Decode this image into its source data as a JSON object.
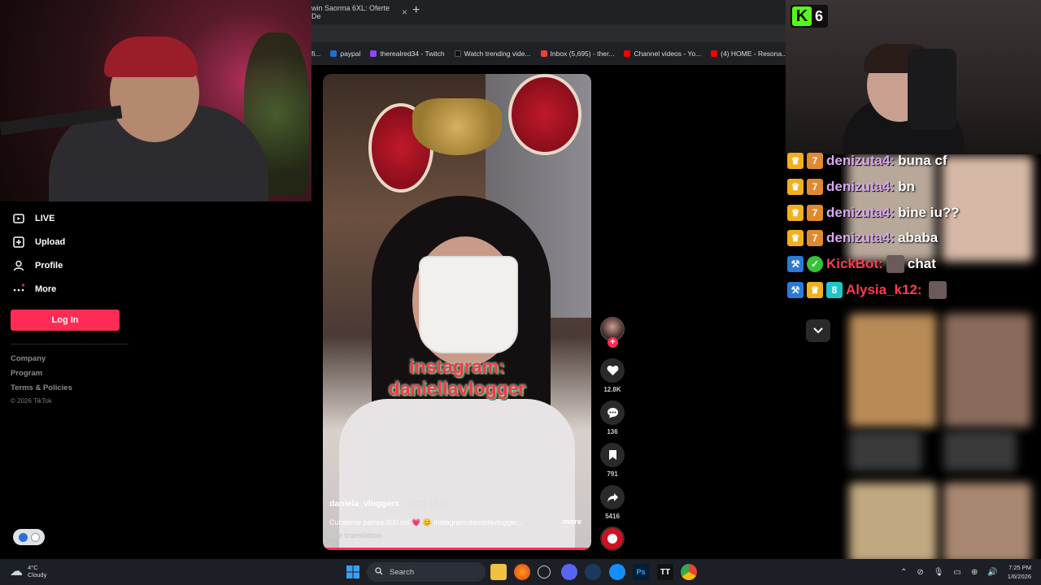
{
  "streamer_overlay": {
    "kick_viewer_count": "6"
  },
  "browser": {
    "active_tab_title": "win Saorma 6XL: Oferte De",
    "bookmarks": [
      {
        "label": "fi..."
      },
      {
        "label": "paypal"
      },
      {
        "label": "therealred34 - Twitch"
      },
      {
        "label": "Watch trending vide..."
      },
      {
        "label": "Inbox (5,695) - ther..."
      },
      {
        "label": "Channel videos - Yo..."
      },
      {
        "label": "(4) HOME - Resona..."
      }
    ]
  },
  "tiktok_sidebar": {
    "nav": [
      {
        "label": "LIVE",
        "icon": "live-icon"
      },
      {
        "label": "Upload",
        "icon": "upload-icon"
      },
      {
        "label": "Profile",
        "icon": "profile-icon"
      },
      {
        "label": "More",
        "icon": "more-icon"
      }
    ],
    "login_label": "Log In",
    "footer_links": [
      "Company",
      "Program",
      "Terms & Policies"
    ],
    "copyright": "© 2026 TikTok"
  },
  "video": {
    "overlay_line1": "instagram:",
    "overlay_line2": "daniellavlogger",
    "author": "daniela_vloggers",
    "date": " · 2025-12-21",
    "caption": "Curatenie partea 900 mil 💗 😊 instagram:daniellavlogger...",
    "more_label": "more",
    "translation_label": "See translation",
    "progress": 1.0
  },
  "actions": {
    "likes": "12.8K",
    "comments": "136",
    "saves": "791",
    "shares": "5416"
  },
  "chat": {
    "messages": [
      {
        "user": "denizuta4:",
        "text": "buna cf",
        "badges": [
          "crown",
          "sub"
        ]
      },
      {
        "user": "denizuta4:",
        "text": "bn",
        "badges": [
          "crown",
          "sub"
        ]
      },
      {
        "user": "denizuta4:",
        "text": "bine iu??",
        "badges": [
          "crown",
          "sub"
        ]
      },
      {
        "user": "denizuta4:",
        "text": "ababa",
        "badges": [
          "crown",
          "sub"
        ]
      },
      {
        "user": "KickBot:",
        "text": "chat",
        "badges": [
          "mod",
          "verified"
        ]
      },
      {
        "user": "Alysia_k12:",
        "text": "",
        "badges": [
          "mod",
          "crown",
          "og"
        ]
      }
    ]
  },
  "taskbar": {
    "weather_temp": "4°C",
    "weather_condition": "Cloudy",
    "search_placeholder": "Search",
    "time": "7:25 PM",
    "date": "1/6/2026"
  },
  "colors": {
    "tiktok_accent": "#fe2c55",
    "kick_green": "#53fc18",
    "chat_username": "#d9a7ee",
    "bot_username": "#ff3a52"
  }
}
